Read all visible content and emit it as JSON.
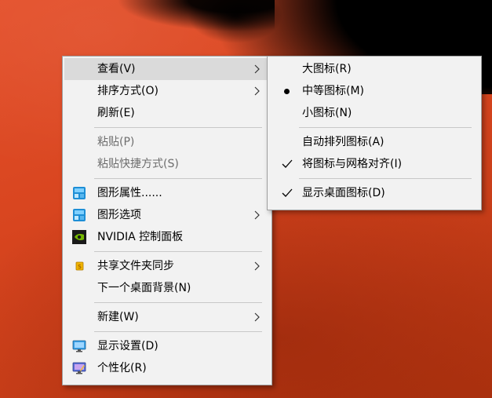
{
  "main_menu": {
    "items": [
      {
        "label": "查看(V)"
      },
      {
        "label": "排序方式(O)"
      },
      {
        "label": "刷新(E)"
      },
      {
        "label": "粘贴(P)"
      },
      {
        "label": "粘贴快捷方式(S)"
      },
      {
        "label": "图形属性......"
      },
      {
        "label": "图形选项"
      },
      {
        "label": "NVIDIA 控制面板"
      },
      {
        "label": "共享文件夹同步"
      },
      {
        "label": "下一个桌面背景(N)"
      },
      {
        "label": "新建(W)"
      },
      {
        "label": "显示设置(D)"
      },
      {
        "label": "个性化(R)"
      }
    ]
  },
  "view_submenu": {
    "items": [
      {
        "label": "大图标(R)"
      },
      {
        "label": "中等图标(M)"
      },
      {
        "label": "小图标(N)"
      },
      {
        "label": "自动排列图标(A)"
      },
      {
        "label": "将图标与网格对齐(I)"
      },
      {
        "label": "显示桌面图标(D)"
      }
    ]
  },
  "icons": {
    "graphics_properties": "intel-graphics-icon",
    "graphics_options": "intel-graphics-icon",
    "nvidia": "nvidia-icon",
    "share_sync": "share-sync-icon",
    "display_settings": "monitor-icon",
    "personalize": "personalize-icon"
  },
  "colors": {
    "menu_bg": "#f2f2f2",
    "hover_bg": "#dadada",
    "disabled_text": "#6d6d6d",
    "wallpaper": "#d8451f"
  }
}
